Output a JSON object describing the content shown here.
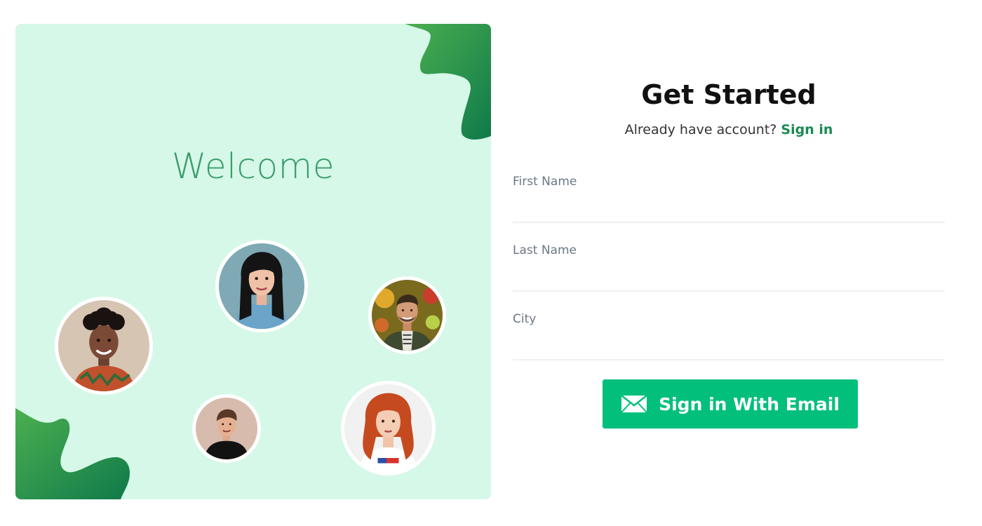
{
  "welcome_panel": {
    "title": "Welcome",
    "bg_color": "#d6f8e8",
    "blob_colors": [
      "#4caf50",
      "#0f7a4a"
    ],
    "avatars": [
      {
        "name": "woman-dark-hair-avatar"
      },
      {
        "name": "man-beard-avatar"
      },
      {
        "name": "woman-curly-hair-avatar"
      },
      {
        "name": "young-man-avatar"
      },
      {
        "name": "woman-red-hair-avatar"
      }
    ]
  },
  "form": {
    "title": "Get Started",
    "subtitle_prefix": "Already have account?",
    "signin_link": "Sign in",
    "fields": [
      {
        "label": "First Name",
        "value": ""
      },
      {
        "label": "Last Name",
        "value": ""
      },
      {
        "label": "City",
        "value": ""
      }
    ],
    "submit_label": "Sign in With Email"
  },
  "colors": {
    "accent": "#03bf7c",
    "link": "#1a8a52",
    "welcome_text": "#3c9d6b"
  },
  "icons": {
    "submit_icon": "envelope-icon"
  }
}
